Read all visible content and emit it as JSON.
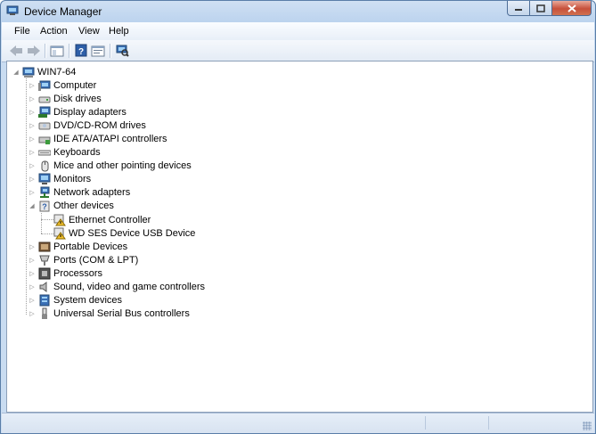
{
  "window": {
    "title": "Device Manager"
  },
  "menu": [
    "File",
    "Action",
    "View",
    "Help"
  ],
  "tree": {
    "root": "WIN7-64",
    "categories": [
      {
        "label": "Computer",
        "icon": "computer-icon"
      },
      {
        "label": "Disk drives",
        "icon": "disk-drive-icon"
      },
      {
        "label": "Display adapters",
        "icon": "display-adapter-icon"
      },
      {
        "label": "DVD/CD-ROM drives",
        "icon": "dvd-drive-icon"
      },
      {
        "label": "IDE ATA/ATAPI controllers",
        "icon": "ide-controller-icon"
      },
      {
        "label": "Keyboards",
        "icon": "keyboard-icon"
      },
      {
        "label": "Mice and other pointing devices",
        "icon": "mouse-icon"
      },
      {
        "label": "Monitors",
        "icon": "monitor-icon"
      },
      {
        "label": "Network adapters",
        "icon": "network-adapter-icon"
      },
      {
        "label": "Other devices",
        "icon": "unknown-device-icon",
        "expanded": true,
        "children": [
          "Ethernet Controller",
          "WD SES Device USB Device"
        ]
      },
      {
        "label": "Portable Devices",
        "icon": "portable-device-icon"
      },
      {
        "label": "Ports (COM & LPT)",
        "icon": "port-icon"
      },
      {
        "label": "Processors",
        "icon": "processor-icon"
      },
      {
        "label": "Sound, video and game controllers",
        "icon": "speaker-icon"
      },
      {
        "label": "System devices",
        "icon": "system-device-icon"
      },
      {
        "label": "Universal Serial Bus controllers",
        "icon": "usb-icon"
      }
    ]
  }
}
